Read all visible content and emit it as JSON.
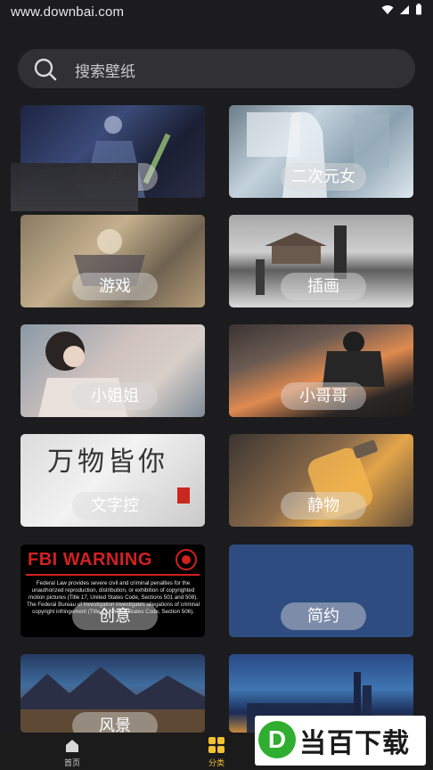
{
  "status": {
    "watermark": "www.downbai.com"
  },
  "search": {
    "placeholder": "搜索壁纸"
  },
  "categories": [
    {
      "label": "男"
    },
    {
      "label": "二次元女"
    },
    {
      "label": "游戏"
    },
    {
      "label": "插画"
    },
    {
      "label": "小姐姐"
    },
    {
      "label": "小哥哥"
    },
    {
      "label": "文字控"
    },
    {
      "label": "静物"
    },
    {
      "label": "创意"
    },
    {
      "label": "简约"
    },
    {
      "label": "风景"
    },
    {
      "label": ""
    }
  ],
  "fbi_image": {
    "title": "FBI WARNING",
    "body": "Federal Law provides severe civil and criminal penalties for the unauthorized reproduction, distribution, or exhibition of copyrighted motion pictures (Title 17, United States Code, Sections 501 and 508). The Federal Bureau of Investigation investigates allegations of criminal copyright infringement (Title 17, United States Code, Section 506)."
  },
  "calligraphy_image": {
    "text": "万物皆你"
  },
  "bottom_nav": [
    {
      "label": "首页",
      "icon": "home-icon",
      "active": false
    },
    {
      "label": "分类",
      "icon": "grid-icon",
      "active": true
    }
  ],
  "brand": {
    "logo_letter": "D",
    "text": "当百下载",
    "logo_color": "#2fae2f"
  },
  "colors": {
    "accent": "#f2c230",
    "background": "#1c1c1e",
    "search_bg": "#313133"
  }
}
